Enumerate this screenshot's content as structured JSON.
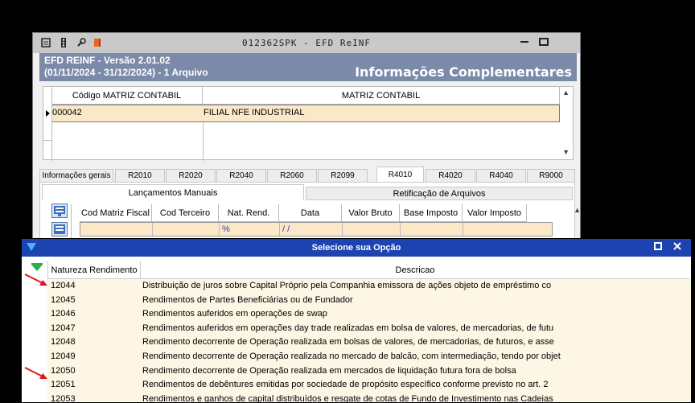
{
  "window": {
    "title": "012362SPK - EFD ReINF",
    "header_line1": "EFD REINF - Versão 2.01.02",
    "header_line2": "(01/11/2024 - 31/12/2024) - 1 Arquivo",
    "header_title": "Informações Complementares"
  },
  "matriz_grid": {
    "columns": [
      "Código MATRIZ CONTABIL",
      "MATRIZ CONTABIL"
    ],
    "row": {
      "codigo": "000042",
      "nome": "FILIAL NFE INDUSTRIAL"
    }
  },
  "tabs": [
    "Informações gerais",
    "R2010",
    "R2020",
    "R2040",
    "R2060",
    "R2099",
    "R4010",
    "R4020",
    "R4040",
    "R9000"
  ],
  "active_tab": "R4010",
  "subtabs": {
    "manual": "Lançamentos Manuais",
    "retificacao": "Retificação de Arquivos"
  },
  "lanc_grid": {
    "columns": [
      "Cod Matriz Fiscal",
      "Cod Terceiro",
      "Nat. Rend.",
      "Data",
      "Valor Bruto",
      "Base Imposto",
      "Valor Imposto"
    ],
    "row": {
      "nat_rend": "%",
      "data": "/ /"
    }
  },
  "popup": {
    "title": "Selecione sua Opção",
    "columns": [
      "Natureza Rendimento",
      "Descricao"
    ],
    "rows": [
      {
        "nat": "12044",
        "desc": "Distribuição de juros sobre Capital Próprio pela Companhia emissora de ações objeto de empréstimo co"
      },
      {
        "nat": "12045",
        "desc": "Rendimentos de Partes Beneficiárias ou de Fundador"
      },
      {
        "nat": "12046",
        "desc": "Rendimentos auferidos em operações de swap"
      },
      {
        "nat": "12047",
        "desc": "Rendimentos auferidos em operações day trade realizadas em bolsa de valores, de mercadorias, de futu"
      },
      {
        "nat": "12048",
        "desc": "Rendimento decorrente de Operação realizada em bolsas de valores, de mercadorias, de futuros, e asse"
      },
      {
        "nat": "12049",
        "desc": "Rendimento decorrente de Operação realizada no mercado de balcão, com intermediação, tendo por objet"
      },
      {
        "nat": "12050",
        "desc": "Rendimento decorrente de Operação realizada em mercados de liquidação futura fora de bolsa"
      },
      {
        "nat": "12051",
        "desc": "Rendimentos de debêntures emitidas por sociedade de propósito específico conforme previsto no art. 2"
      },
      {
        "nat": "12053",
        "desc": "Rendimentos e ganhos de capital distribuídos e resgate de cotas de Fundo de Investimento nas Cadeias"
      }
    ]
  },
  "colors": {
    "header_bg": "#7a8aa8",
    "popup_title_bg": "#1c43b0",
    "row_highlight": "#fbe8c9",
    "arrow": "#e0141e"
  }
}
